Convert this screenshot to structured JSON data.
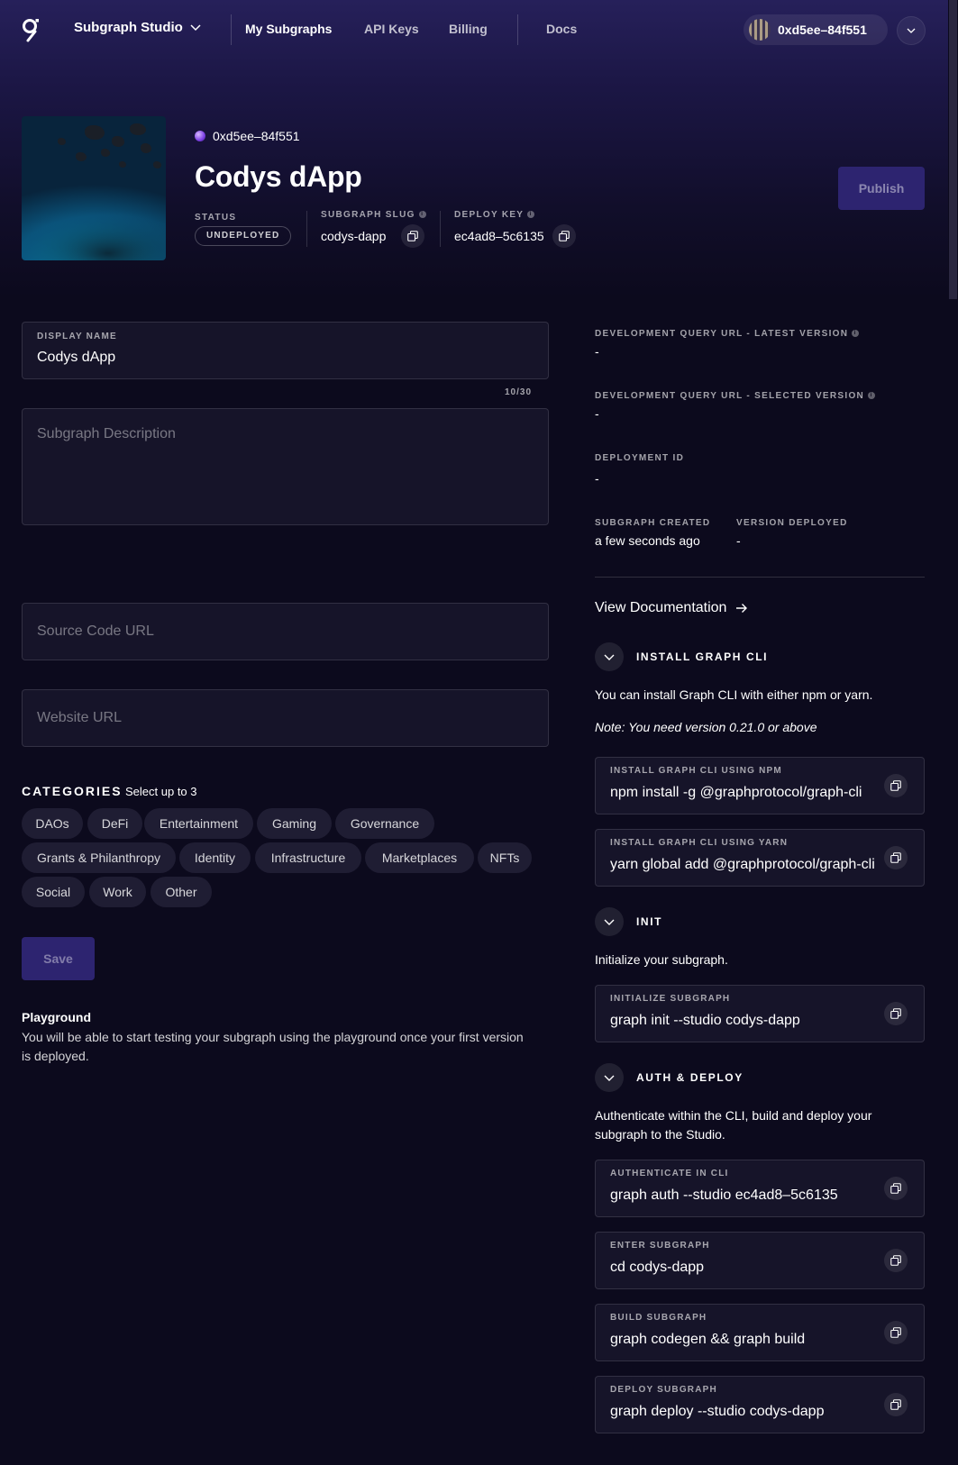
{
  "nav": {
    "studio_label": "Subgraph Studio",
    "links": [
      "My Subgraphs",
      "API Keys",
      "Billing",
      "Docs"
    ],
    "account": "0xd5ee–84f551"
  },
  "header": {
    "owner": "0xd5ee–84f551",
    "title": "Codys dApp",
    "status_label": "STATUS",
    "status_value": "UNDEPLOYED",
    "slug_label": "SUBGRAPH SLUG",
    "slug_value": "codys-dapp",
    "deploy_key_label": "DEPLOY KEY",
    "deploy_key_value": "ec4ad8–5c6135",
    "publish_label": "Publish"
  },
  "form": {
    "display_name_label": "DISPLAY NAME",
    "display_name_value": "Codys dApp",
    "counter": "10/30",
    "description_placeholder": "Subgraph Description",
    "source_placeholder": "Source Code URL",
    "website_placeholder": "Website URL",
    "categories_title": "CATEGORIES",
    "categories_sub": "Select up to 3",
    "categories": [
      "DAOs",
      "DeFi",
      "Entertainment",
      "Gaming",
      "Governance",
      "Grants & Philanthropy",
      "Identity",
      "Infrastructure",
      "Marketplaces",
      "NFTs",
      "Social",
      "Work",
      "Other"
    ],
    "save_label": "Save",
    "playground_title": "Playground",
    "playground_text": "You will be able to start testing your subgraph using the playground once your first version is deployed."
  },
  "details": {
    "latest_url_label": "DEVELOPMENT QUERY URL - LATEST VERSION",
    "latest_url_value": "-",
    "selected_url_label": "DEVELOPMENT QUERY URL - SELECTED VERSION",
    "selected_url_value": "-",
    "deployment_id_label": "DEPLOYMENT ID",
    "deployment_id_value": "-",
    "created_label": "SUBGRAPH CREATED",
    "created_value": "a few seconds ago",
    "version_label": "VERSION DEPLOYED",
    "version_value": "-",
    "doc_link": "View Documentation"
  },
  "sections": {
    "install": {
      "title": "INSTALL GRAPH CLI",
      "text": "You can install Graph CLI with either npm or yarn.",
      "note": "Note: You need version 0.21.0 or above",
      "npm_label": "INSTALL GRAPH CLI USING NPM",
      "npm_cmd": "npm install -g @graphprotocol/graph-cli",
      "yarn_label": "INSTALL GRAPH CLI USING YARN",
      "yarn_cmd": "yarn global add @graphprotocol/graph-cli"
    },
    "init": {
      "title": "INIT",
      "text": "Initialize your subgraph.",
      "label": "INITIALIZE SUBGRAPH",
      "cmd": "graph init --studio codys-dapp"
    },
    "deploy": {
      "title": "AUTH & DEPLOY",
      "text": "Authenticate within the CLI, build and deploy your subgraph to the Studio.",
      "auth_label": "AUTHENTICATE IN CLI",
      "auth_cmd": "graph auth --studio ec4ad8–5c6135",
      "enter_label": "ENTER SUBGRAPH",
      "enter_cmd": "cd codys-dapp",
      "build_label": "BUILD SUBGRAPH",
      "build_cmd": "graph codegen && graph build",
      "deploy_label": "DEPLOY SUBGRAPH",
      "deploy_cmd": "graph deploy --studio codys-dapp"
    }
  },
  "colors": {
    "background": "#0c0a1d",
    "accent": "#2d2470",
    "field": "#161429"
  }
}
